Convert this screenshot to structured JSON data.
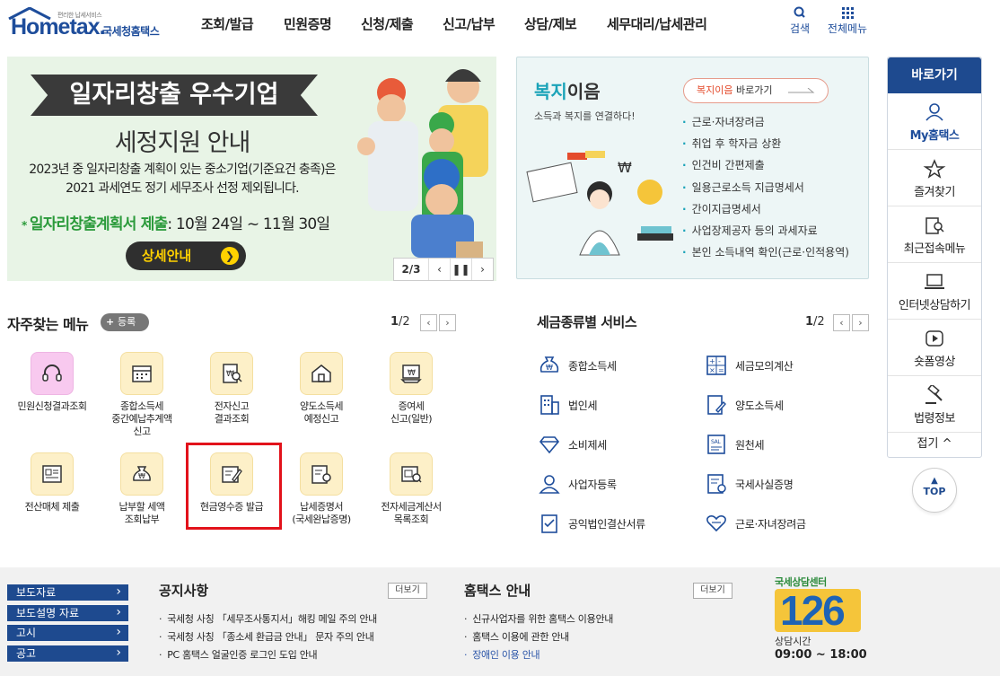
{
  "header": {
    "logo_text": "Hometax.",
    "logo_sub": "편리한 납세서비스",
    "logo_kr": "국세청홈택스",
    "nav": [
      "조회/발급",
      "민원증명",
      "신청/제출",
      "신고/납부",
      "상담/제보",
      "세무대리/납세관리"
    ],
    "search_label": "검색",
    "menu_label": "전체메뉴"
  },
  "banner": {
    "title": "일자리창출 우수기업",
    "subtitle": "세정지원 안내",
    "desc1": "2023년 중 일자리창출 계획이 있는 중소기업(기준요건 충족)은",
    "desc2": "2021 과세연도 정기 세무조사 선정 제외됩니다.",
    "date_label": "일자리창출계획서 제출",
    "date_range": ": 10월 24일 ~ 11월 30일",
    "button": "상세안내",
    "page_indicator": "2/3"
  },
  "welfare": {
    "title_a": "복지",
    "title_b": "이음",
    "desc": "소득과 복지를 연결하다!",
    "go_a": "복지이음",
    "go_b": " 바로가기",
    "items": [
      "근로·자녀장려금",
      "취업 후 학자금 상환",
      "인건비 간편제출",
      "일용근로소득 지급명세서",
      "간이지급명세서",
      "사업장제공자 등의 과세자료",
      "본인 소득내역 확인(근로·인적용역)"
    ]
  },
  "frequent": {
    "title": "자주찾는 메뉴",
    "register": "등록",
    "page_current": "1",
    "page_total": "/2",
    "items": [
      [
        "민원신청결과조회"
      ],
      [
        "종합소득세",
        "중간예납추계액",
        "신고"
      ],
      [
        "전자신고",
        "결과조회"
      ],
      [
        "양도소득세",
        "예정신고"
      ],
      [
        "증여세",
        "신고(일반)"
      ],
      [
        "전산매체 제출"
      ],
      [
        "납부할 세액",
        "조회납부"
      ],
      [
        "현금영수증 발급"
      ],
      [
        "납세증명서",
        "(국세완납증명)"
      ],
      [
        "전자세금계산서",
        "목록조회"
      ]
    ]
  },
  "taxservice": {
    "title": "세금종류별 서비스",
    "page_current": "1",
    "page_total": "/2",
    "left": [
      "종합소득세",
      "법인세",
      "소비제세",
      "사업자등록",
      "공익법인결산서류"
    ],
    "right": [
      "세금모의계산",
      "양도소득세",
      "원천세",
      "국세사실증명",
      "근로·자녀장려금"
    ]
  },
  "quick": {
    "title": "바로가기",
    "items": [
      "My홈택스",
      "즐겨찾기",
      "최근접속메뉴",
      "인터넷상담하기",
      "숏폼영상",
      "법령정보"
    ],
    "fold": "접기 ^",
    "top": "TOP"
  },
  "footer": {
    "links": [
      "보도자료",
      "보도설명 자료",
      "고시",
      "공고"
    ],
    "notice_title": "공지사항",
    "notice_more": "더보기",
    "notices": [
      "국세청 사칭 「세무조사통지서」해킹 메일 주의 안내",
      "국세청 사칭 「종소세 환급금 안내」 문자 주의 안내",
      "PC 홈택스 얼굴인증 로그인 도입 안내"
    ],
    "guide_title": "홈택스 안내",
    "guide_more": "더보기",
    "guides": [
      "신규사업자를 위한 홈택스 이용안내",
      "홈택스 이용에 관한 안내",
      "장애인 이용 안내"
    ],
    "center_title": "국세상담센터",
    "center_number": "126",
    "center_hours_label": "상담시간",
    "center_hours": "09:00 ~ 18:00"
  },
  "colors": {
    "brand": "#1e4d9b",
    "highlight": "#e2121b",
    "welfare_accent": "#1aa3b8"
  }
}
